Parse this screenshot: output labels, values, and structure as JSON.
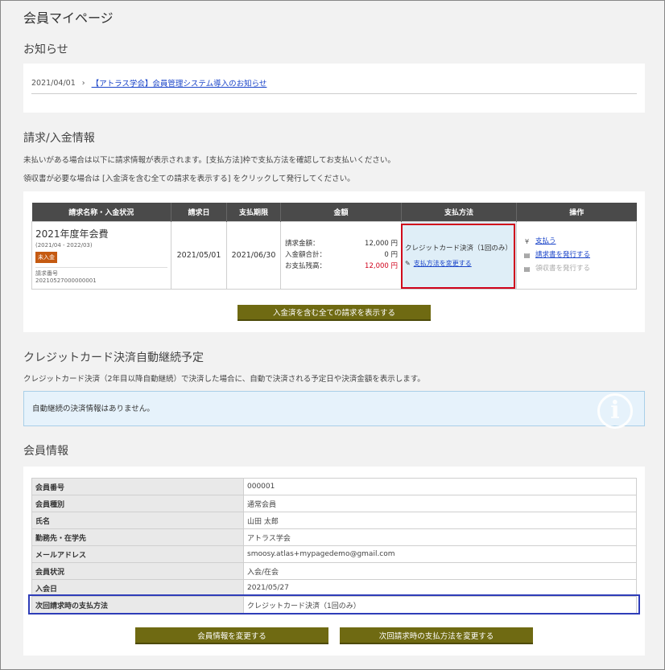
{
  "page_title": "会員マイページ",
  "notice": {
    "title": "お知らせ",
    "items": [
      {
        "date": "2021/04/01",
        "text": "【アトラス学会】会員管理システム導入のお知らせ"
      }
    ]
  },
  "billing": {
    "title": "請求/入金情報",
    "desc1": "未払いがある場合は以下に請求情報が表示されます。[支払方法]枠で支払方法を確認してお支払いください。",
    "desc2": "領収書が必要な場合は [入金済を含む全ての請求を表示する] をクリックして発行してください。",
    "headers": [
      "請求名称・入金状況",
      "請求日",
      "支払期限",
      "金額",
      "支払方法",
      "操作"
    ],
    "row": {
      "name": "2021年度年会費",
      "period": "(2021/04 - 2022/03)",
      "status": "未入金",
      "number_label": "請求番号",
      "number": "20210527000000001",
      "invoice_date": "2021/05/01",
      "due_date": "2021/06/30",
      "amount_label": "請求金額：",
      "amount": "12,000 円",
      "paid_label": "入金額合計：",
      "paid": "0 円",
      "balance_label": "お支払残高：",
      "balance": "12,000 円",
      "pay_method": "クレジットカード決済（1回のみ）",
      "change_method": "支払方法を変更する",
      "op_pay": "支払う",
      "op_invoice": "請求書を発行する",
      "op_receipt": "領収書を発行する"
    },
    "show_all_button": "入金済を含む全ての請求を表示する"
  },
  "auto": {
    "title": "クレジットカード決済自動継続予定",
    "desc": "クレジットカード決済（2年目以降自動継続）で決済した場合に、自動で決済される予定日や決済金額を表示します。",
    "empty": "自動継続の決済情報はありません。"
  },
  "member": {
    "title": "会員情報",
    "rows": [
      {
        "label": "会員番号",
        "value": "000001"
      },
      {
        "label": "会員種別",
        "value": "通常会員"
      },
      {
        "label": "氏名",
        "value": "山田 太郎"
      },
      {
        "label": "勤務先・在学先",
        "value": "アトラス学会"
      },
      {
        "label": "メールアドレス",
        "value": "smoosy.atlas+mypagedemo@gmail.com"
      },
      {
        "label": "会員状況",
        "value": "入会/在会"
      },
      {
        "label": "入会日",
        "value": "2021/05/27"
      },
      {
        "label": "次回請求時の支払方法",
        "value": "クレジットカード決済（1回のみ）"
      }
    ],
    "edit_button": "会員情報を変更する",
    "change_pay_button": "次回請求時の支払方法を変更する"
  },
  "colors": {
    "olive": "#6f6a12",
    "header_dark": "#4a4a4a",
    "unpaid_badge": "#c55a11",
    "highlight_red": "#d0021b",
    "highlight_blue": "#2e3db8",
    "info_bg": "#e6f2fb"
  },
  "icons": [
    "chevron-right-icon",
    "yen-icon",
    "document-icon",
    "pencil-icon",
    "info-icon"
  ]
}
